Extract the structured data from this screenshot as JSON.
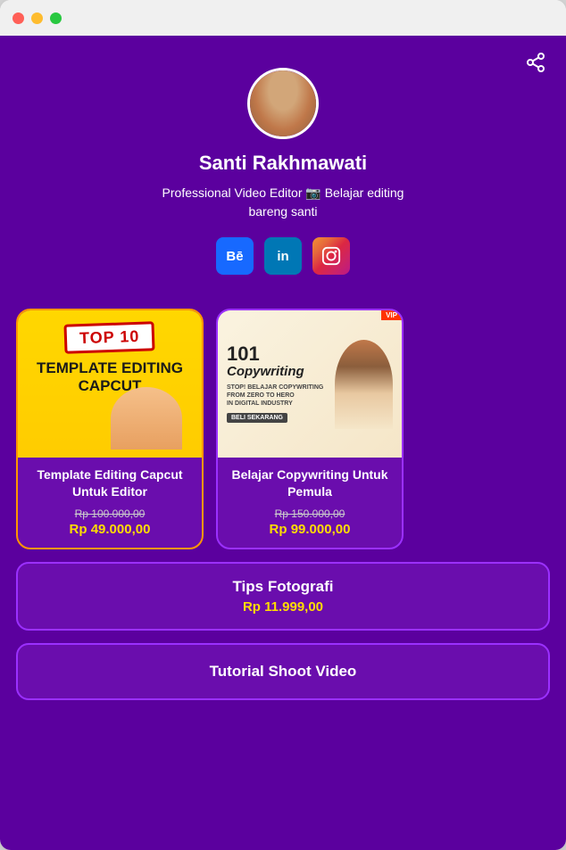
{
  "window": {
    "dots": [
      "red",
      "yellow",
      "green"
    ]
  },
  "profile": {
    "name": "Santi Rakhmawati",
    "bio_prefix": "Professional Video Editor",
    "bio_emoji": "📷",
    "bio_suffix": "Belajar editing bareng santi"
  },
  "social": {
    "behance_label": "Bē",
    "linkedin_label": "in",
    "instagram_label": "♡"
  },
  "products": [
    {
      "id": "product-1",
      "thumbnail_type": "capcut",
      "badge": "TOP 10",
      "thumb_text": "TEMPLATE EDITING CAPCUT",
      "title": "Template Editing Capcut Untuk Editor",
      "original_price": "Rp 100.000,00",
      "discounted_price": "Rp 49.000,00"
    },
    {
      "id": "product-2",
      "thumbnail_type": "copywriting",
      "badge": "VIP",
      "copy_number": "101",
      "copy_title": "Copywriting",
      "copy_subtitle": "STOP! BELAJAR COPYWRITING\nFROM ZERO TO HERO\nIN DIGITAL INDUSTRY",
      "copy_cta": "BELI SEKARANG",
      "title": "Belajar Copywriting Untuk Pemula",
      "original_price": "Rp 150.000,00",
      "discounted_price": "Rp 99.000,00"
    }
  ],
  "list_items": [
    {
      "id": "tips-fotografi",
      "title": "Tips Fotografi",
      "price": "Rp 11.999,00",
      "has_price": true
    },
    {
      "id": "tutorial-shoot-video",
      "title": "Tutorial Shoot Video",
      "price": null,
      "has_price": false
    }
  ]
}
